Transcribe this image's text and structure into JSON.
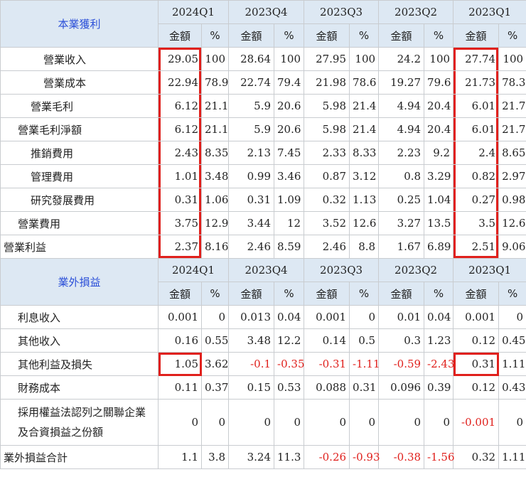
{
  "quarters": [
    "2024Q1",
    "2023Q4",
    "2023Q3",
    "2023Q2",
    "2023Q1"
  ],
  "amount_label": "金額",
  "pct_label": "%",
  "sections": [
    {
      "title": "本業獲利",
      "rows": [
        {
          "label": "營業收入",
          "indent": 60,
          "values": [
            "29.05",
            "100",
            "28.64",
            "100",
            "27.95",
            "100",
            "24.2",
            "100",
            "27.74",
            "100"
          ]
        },
        {
          "label": "營業成本",
          "indent": 60,
          "values": [
            "22.94",
            "78.9",
            "22.74",
            "79.4",
            "21.98",
            "78.6",
            "19.27",
            "79.6",
            "21.73",
            "78.3"
          ]
        },
        {
          "label": "營業毛利",
          "indent": 42,
          "values": [
            "6.12",
            "21.1",
            "5.9",
            "20.6",
            "5.98",
            "21.4",
            "4.94",
            "20.4",
            "6.01",
            "21.7"
          ]
        },
        {
          "label": "營業毛利淨額",
          "indent": 24,
          "values": [
            "6.12",
            "21.1",
            "5.9",
            "20.6",
            "5.98",
            "21.4",
            "4.94",
            "20.4",
            "6.01",
            "21.7"
          ]
        },
        {
          "label": "推銷費用",
          "indent": 42,
          "values": [
            "2.43",
            "8.35",
            "2.13",
            "7.45",
            "2.33",
            "8.33",
            "2.23",
            "9.2",
            "2.4",
            "8.65"
          ]
        },
        {
          "label": "管理費用",
          "indent": 42,
          "values": [
            "1.01",
            "3.48",
            "0.99",
            "3.46",
            "0.87",
            "3.12",
            "0.8",
            "3.29",
            "0.82",
            "2.97"
          ]
        },
        {
          "label": "研究發展費用",
          "indent": 42,
          "values": [
            "0.31",
            "1.06",
            "0.31",
            "1.09",
            "0.32",
            "1.13",
            "0.25",
            "1.04",
            "0.27",
            "0.98"
          ]
        },
        {
          "label": "營業費用",
          "indent": 24,
          "values": [
            "3.75",
            "12.9",
            "3.44",
            "12",
            "3.52",
            "12.6",
            "3.27",
            "13.5",
            "3.5",
            "12.6"
          ]
        },
        {
          "label": "營業利益",
          "indent": 4,
          "values": [
            "2.37",
            "8.16",
            "2.46",
            "8.59",
            "2.46",
            "8.8",
            "1.67",
            "6.89",
            "2.51",
            "9.06"
          ]
        }
      ]
    },
    {
      "title": "業外損益",
      "rows": [
        {
          "label": "利息收入",
          "indent": 24,
          "values": [
            "0.001",
            "0",
            "0.013",
            "0.04",
            "0.001",
            "0",
            "0.01",
            "0.04",
            "0.001",
            "0"
          ]
        },
        {
          "label": "其他收入",
          "indent": 24,
          "values": [
            "0.16",
            "0.55",
            "3.48",
            "12.2",
            "0.14",
            "0.5",
            "0.3",
            "1.23",
            "0.12",
            "0.45"
          ]
        },
        {
          "label": "其他利益及損失",
          "indent": 24,
          "values": [
            "1.05",
            "3.62",
            "-0.1",
            "-0.35",
            "-0.31",
            "-1.11",
            "-0.59",
            "-2.43",
            "0.31",
            "1.11"
          ]
        },
        {
          "label": "財務成本",
          "indent": 24,
          "values": [
            "0.11",
            "0.37",
            "0.15",
            "0.53",
            "0.088",
            "0.31",
            "0.096",
            "0.39",
            "0.12",
            "0.43"
          ]
        },
        {
          "label": "採用權益法認列之關聯企業及合資損益之份額",
          "indent": 24,
          "values": [
            "0",
            "0",
            "0",
            "0",
            "0",
            "0",
            "0",
            "0",
            "-0.001",
            "0"
          ]
        },
        {
          "label": "業外損益合計",
          "indent": 4,
          "values": [
            "1.1",
            "3.8",
            "3.24",
            "11.3",
            "-0.26",
            "-0.93",
            "-0.38",
            "-1.56",
            "0.32",
            "1.11"
          ]
        }
      ]
    }
  ],
  "colors": {
    "header_bg": "#dde8f3",
    "section_title": "#2b4fd8",
    "negative": "#e0201c",
    "highlight": "#e0201c"
  }
}
